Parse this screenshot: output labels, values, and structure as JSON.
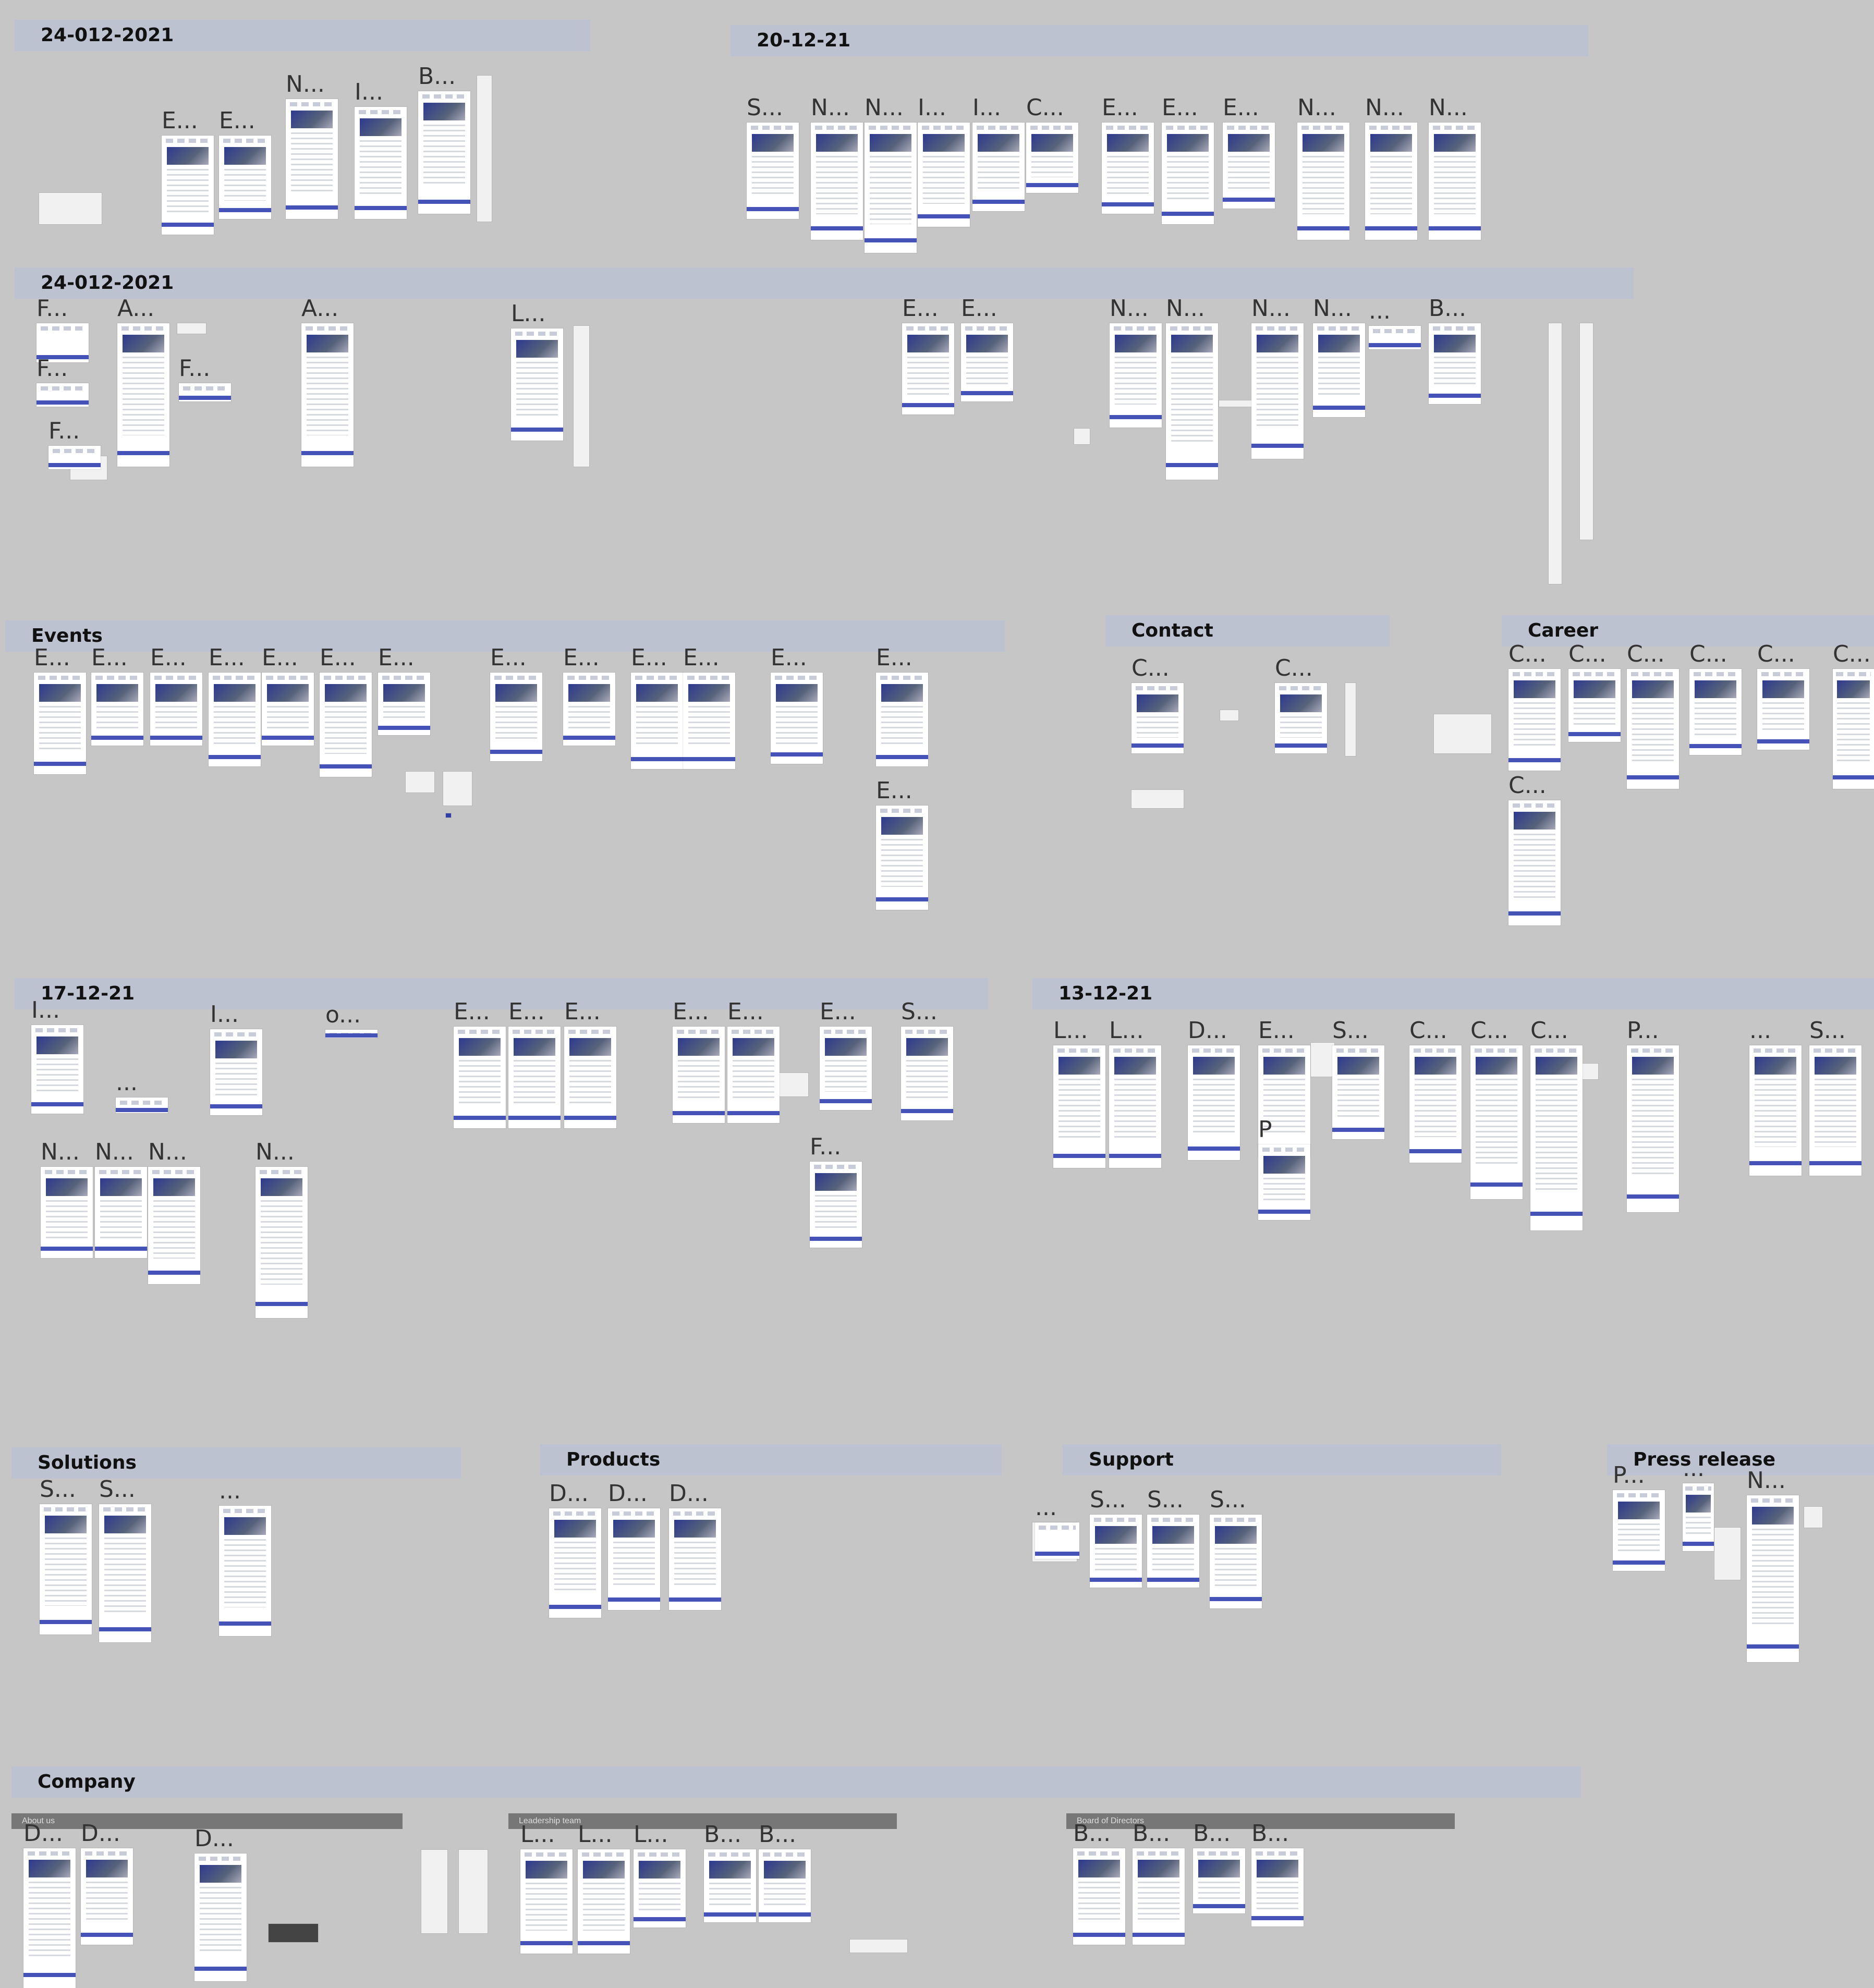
{
  "sections": [
    {
      "id": "s1",
      "title": "24-012-2021"
    },
    {
      "id": "s2",
      "title": "20-12-21"
    },
    {
      "id": "s3",
      "title": "24-012-2021"
    },
    {
      "id": "s4",
      "title": "Events"
    },
    {
      "id": "s5",
      "title": "Contact"
    },
    {
      "id": "s6",
      "title": "Career"
    },
    {
      "id": "s7",
      "title": "17-12-21"
    },
    {
      "id": "s8",
      "title": "13-12-21"
    },
    {
      "id": "s9",
      "title": "Solutions"
    },
    {
      "id": "s10",
      "title": "Products"
    },
    {
      "id": "s11",
      "title": "Support"
    },
    {
      "id": "s12",
      "title": "Press release"
    },
    {
      "id": "s13",
      "title": "Company"
    }
  ],
  "subsections": [
    {
      "id": "c1",
      "title": "About us"
    },
    {
      "id": "c2",
      "title": "Leadership team"
    },
    {
      "id": "c3",
      "title": "Board of Directors"
    }
  ],
  "frames": [
    {
      "label": "E..."
    },
    {
      "label": "E..."
    },
    {
      "label": "N..."
    },
    {
      "label": "I..."
    },
    {
      "label": "B..."
    },
    {
      "label": "S..."
    },
    {
      "label": "N..."
    },
    {
      "label": "N..."
    },
    {
      "label": "I..."
    },
    {
      "label": "I..."
    },
    {
      "label": "C..."
    },
    {
      "label": "E..."
    },
    {
      "label": "E..."
    },
    {
      "label": "E..."
    },
    {
      "label": "N..."
    },
    {
      "label": "N..."
    },
    {
      "label": "N..."
    },
    {
      "label": "F..."
    },
    {
      "label": "A..."
    },
    {
      "label": "F..."
    },
    {
      "label": "F..."
    },
    {
      "label": "F..."
    },
    {
      "label": "A..."
    },
    {
      "label": "L..."
    },
    {
      "label": "E..."
    },
    {
      "label": "E..."
    },
    {
      "label": "N..."
    },
    {
      "label": "N..."
    },
    {
      "label": "N..."
    },
    {
      "label": "N..."
    },
    {
      "label": "..."
    },
    {
      "label": "B..."
    },
    {
      "label": "E..."
    },
    {
      "label": "E..."
    },
    {
      "label": "E..."
    },
    {
      "label": "E..."
    },
    {
      "label": "E..."
    },
    {
      "label": "E..."
    },
    {
      "label": "E..."
    },
    {
      "label": "E..."
    },
    {
      "label": "E..."
    },
    {
      "label": "E..."
    },
    {
      "label": "E..."
    },
    {
      "label": "E..."
    },
    {
      "label": "E..."
    },
    {
      "label": "E..."
    },
    {
      "label": "C..."
    },
    {
      "label": "C..."
    },
    {
      "label": "C..."
    },
    {
      "label": "C..."
    },
    {
      "label": "C..."
    },
    {
      "label": "C..."
    },
    {
      "label": "C..."
    },
    {
      "label": "C..."
    },
    {
      "label": "C..."
    },
    {
      "label": "I..."
    },
    {
      "label": "..."
    },
    {
      "label": "I..."
    },
    {
      "label": "o..."
    },
    {
      "label": "E..."
    },
    {
      "label": "E..."
    },
    {
      "label": "E..."
    },
    {
      "label": "E..."
    },
    {
      "label": "E..."
    },
    {
      "label": "E..."
    },
    {
      "label": "S..."
    },
    {
      "label": "N..."
    },
    {
      "label": "N..."
    },
    {
      "label": "N..."
    },
    {
      "label": "N..."
    },
    {
      "label": "F..."
    },
    {
      "label": "L..."
    },
    {
      "label": "L..."
    },
    {
      "label": "D..."
    },
    {
      "label": "E..."
    },
    {
      "label": "P"
    },
    {
      "label": "S..."
    },
    {
      "label": "C..."
    },
    {
      "label": "C..."
    },
    {
      "label": "C..."
    },
    {
      "label": "P..."
    },
    {
      "label": "..."
    },
    {
      "label": "S..."
    },
    {
      "label": "S..."
    },
    {
      "label": "S..."
    },
    {
      "label": "..."
    },
    {
      "label": "D..."
    },
    {
      "label": "D..."
    },
    {
      "label": "D..."
    },
    {
      "label": "..."
    },
    {
      "label": "S..."
    },
    {
      "label": "S..."
    },
    {
      "label": "S..."
    },
    {
      "label": "P..."
    },
    {
      "label": "..."
    },
    {
      "label": "N..."
    },
    {
      "label": "D..."
    },
    {
      "label": "D..."
    },
    {
      "label": "D..."
    },
    {
      "label": "L..."
    },
    {
      "label": "L..."
    },
    {
      "label": "L..."
    },
    {
      "label": "B..."
    },
    {
      "label": "B..."
    },
    {
      "label": "B..."
    },
    {
      "label": "B..."
    },
    {
      "label": "B..."
    },
    {
      "label": "B..."
    }
  ]
}
